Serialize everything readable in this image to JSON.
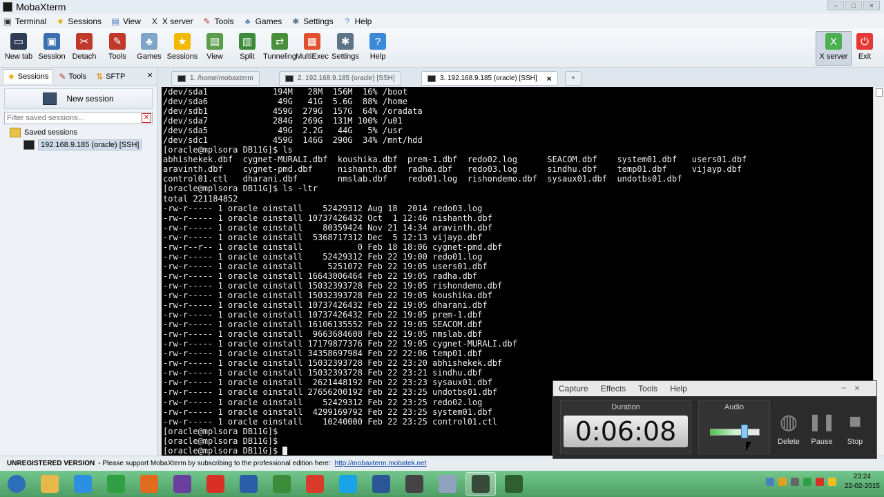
{
  "app": {
    "title": "MobaXterm"
  },
  "menu": [
    {
      "label": "Terminal",
      "icon": "terminal-icon"
    },
    {
      "label": "Sessions",
      "icon": "star-icon"
    },
    {
      "label": "View",
      "icon": "view-icon"
    },
    {
      "label": "X server",
      "icon": "x-icon"
    },
    {
      "label": "Tools",
      "icon": "tools-icon"
    },
    {
      "label": "Games",
      "icon": "games-icon"
    },
    {
      "label": "Settings",
      "icon": "settings-icon"
    },
    {
      "label": "Help",
      "icon": "help-icon"
    }
  ],
  "toolbar": {
    "buttons": [
      {
        "label": "New tab",
        "icon": "new-tab-icon",
        "color": "#2f3e55"
      },
      {
        "label": "Session",
        "icon": "session-icon",
        "color": "#3a6fb0"
      },
      {
        "label": "Detach",
        "icon": "detach-icon",
        "color": "#c0392b"
      },
      {
        "label": "Tools",
        "icon": "tools-icon",
        "color": "#c0392b"
      },
      {
        "label": "Games",
        "icon": "games-icon",
        "color": "#7fa6c8"
      },
      {
        "label": "Sessions",
        "icon": "star-icon",
        "color": "#f2b900"
      },
      {
        "label": "View",
        "icon": "view-icon",
        "color": "#5a9e4a"
      },
      {
        "label": "Split",
        "icon": "split-icon",
        "color": "#3c8a3a"
      },
      {
        "label": "Tunneling",
        "icon": "tunneling-icon",
        "color": "#4a8f3c"
      },
      {
        "label": "MultiExec",
        "icon": "multiexec-icon",
        "color": "#e0502d"
      },
      {
        "label": "Settings",
        "icon": "settings-icon",
        "color": "#5f7389"
      },
      {
        "label": "Help",
        "icon": "help-icon",
        "color": "#3b8ad9"
      }
    ],
    "right_buttons": [
      {
        "label": "X server",
        "icon": "x-server-icon",
        "color": "#4caf50",
        "active": true
      },
      {
        "label": "Exit",
        "icon": "exit-icon",
        "color": "#e53935"
      }
    ]
  },
  "left_panel": {
    "tabs": [
      {
        "label": "Sessions",
        "icon": "star-icon"
      },
      {
        "label": "Tools",
        "icon": "tools-icon"
      },
      {
        "label": "SFTP",
        "icon": "sftp-icon"
      }
    ],
    "close": "×",
    "new_session": "New session",
    "filter_placeholder": "Filter saved sessions...",
    "tree": {
      "folder": "Saved sessions",
      "items": [
        "192.168.9.185 (oracle) [SSH]"
      ]
    }
  },
  "term_tabs": [
    {
      "label": "1. /home/mobaxterm",
      "active": false
    },
    {
      "label": "2. 192.168.9.185 (oracle) [SSH]",
      "active": false
    },
    {
      "label": "3. 192.168.9.185 (oracle) [SSH]",
      "active": true
    }
  ],
  "terminal": {
    "lines": [
      "/dev/sda1             194M   28M  156M  16% /boot",
      "/dev/sda6              49G   41G  5.6G  88% /home",
      "/dev/sdb1             459G  279G  157G  64% /oradata",
      "/dev/sda7             284G  269G  131M 100% /u01",
      "/dev/sda5              49G  2.2G   44G   5% /usr",
      "/dev/sdc1             459G  146G  290G  34% /mnt/hdd",
      "[oracle@mplsora DB11G]$ ls",
      "abhishekek.dbf  cygnet-MURALI.dbf  koushika.dbf  prem-1.dbf  redo02.log      SEACOM.dbf    system01.dbf   users01.dbf",
      "aravinth.dbf    cygnet-pmd.dbf     nishanth.dbf  radha.dbf   redo03.log      sindhu.dbf    temp01.dbf     vijayp.dbf",
      "control01.ctl   dharani.dbf        nmslab.dbf    redo01.log  rishondemo.dbf  sysaux01.dbf  undotbs01.dbf",
      "[oracle@mplsora DB11G]$ ls -ltr",
      "total 221184852",
      "-rw-r----- 1 oracle oinstall    52429312 Aug 18  2014 redo03.log",
      "-rw-r----- 1 oracle oinstall 10737426432 Oct  1 12:46 nishanth.dbf",
      "-rw-r----- 1 oracle oinstall    80359424 Nov 21 14:34 aravinth.dbf",
      "-rw-r----- 1 oracle oinstall  5368717312 Dec  5 12:13 vijayp.dbf",
      "-rw-r--r-- 1 oracle oinstall           0 Feb 18 18:06 cygnet-pmd.dbf",
      "-rw-r----- 1 oracle oinstall    52429312 Feb 22 19:00 redo01.log",
      "-rw-r----- 1 oracle oinstall     5251072 Feb 22 19:05 users01.dbf",
      "-rw-r----- 1 oracle oinstall 16643006464 Feb 22 19:05 radha.dbf",
      "-rw-r----- 1 oracle oinstall 15032393728 Feb 22 19:05 rishondemo.dbf",
      "-rw-r----- 1 oracle oinstall 15032393728 Feb 22 19:05 koushika.dbf",
      "-rw-r----- 1 oracle oinstall 10737426432 Feb 22 19:05 dharani.dbf",
      "-rw-r----- 1 oracle oinstall 10737426432 Feb 22 19:05 prem-1.dbf",
      "-rw-r----- 1 oracle oinstall 16106135552 Feb 22 19:05 SEACOM.dbf",
      "-rw-r----- 1 oracle oinstall  9663684608 Feb 22 19:05 nmslab.dbf",
      "-rw-r----- 1 oracle oinstall 17179877376 Feb 22 19:05 cygnet-MURALI.dbf",
      "-rw-r----- 1 oracle oinstall 34358697984 Feb 22 22:06 temp01.dbf",
      "-rw-r----- 1 oracle oinstall 15032393728 Feb 22 23:20 abhishekek.dbf",
      "-rw-r----- 1 oracle oinstall 15032393728 Feb 22 23:21 sindhu.dbf",
      "-rw-r----- 1 oracle oinstall  2621448192 Feb 22 23:23 sysaux01.dbf",
      "-rw-r----- 1 oracle oinstall 27656200192 Feb 22 23:25 undotbs01.dbf",
      "-rw-r----- 1 oracle oinstall    52429312 Feb 22 23:25 redo02.log",
      "-rw-r----- 1 oracle oinstall  4299169792 Feb 22 23:25 system01.dbf",
      "-rw-r----- 1 oracle oinstall    10240000 Feb 22 23:25 control01.ctl",
      "[oracle@mplsora DB11G]$",
      "[oracle@mplsora DB11G]$"
    ],
    "prompt": "[oracle@mplsora DB11G]$ "
  },
  "statusbar": {
    "unregistered": "UNREGISTERED VERSION",
    "message": "-  Please support MobaXterm by subscribing to the professional edition here:",
    "link": "http://mobaxterm.mobatek.net"
  },
  "recorder": {
    "menu": [
      "Capture",
      "Effects",
      "Tools",
      "Help"
    ],
    "minimize": "–",
    "close": "×",
    "duration_label": "Duration",
    "duration": "0:06:08",
    "audio_label": "Audio",
    "audio_level": 0.7,
    "buttons": [
      {
        "label": "Delete",
        "icon": "delete-icon"
      },
      {
        "label": "Pause",
        "icon": "pause-icon"
      },
      {
        "label": "Stop",
        "icon": "stop-icon"
      }
    ]
  },
  "taskbar": {
    "apps": [
      {
        "icon": "start-orb-icon",
        "color": "#2a6fb8",
        "active": false
      },
      {
        "icon": "file-explorer-icon",
        "color": "#e8b84a",
        "active": false
      },
      {
        "icon": "internet-explorer-icon",
        "color": "#2d8fe0",
        "active": false
      },
      {
        "icon": "store-icon",
        "color": "#2ea043",
        "active": false
      },
      {
        "icon": "firefox-icon",
        "color": "#e06b1f",
        "active": false
      },
      {
        "icon": "visual-studio-icon",
        "color": "#6a3fa0",
        "active": false
      },
      {
        "icon": "chrome-icon",
        "color": "#d93025",
        "active": false
      },
      {
        "icon": "remote-desktop-icon",
        "color": "#2b5ea7",
        "active": false
      },
      {
        "icon": "project-icon",
        "color": "#3d8c3a",
        "active": false
      },
      {
        "icon": "acrobat-icon",
        "color": "#d93a2b",
        "active": false
      },
      {
        "icon": "skype-icon",
        "color": "#1aa3e8",
        "active": false
      },
      {
        "icon": "word-icon",
        "color": "#2b5797",
        "active": false
      },
      {
        "icon": "screen-icon",
        "color": "#444444",
        "active": false
      },
      {
        "icon": "database-icon",
        "color": "#8ea3bd",
        "active": false
      },
      {
        "icon": "mobaxterm-icon",
        "color": "#3a4a3a",
        "active": true
      },
      {
        "icon": "recorder-icon",
        "color": "#2f5f2f",
        "active": false
      }
    ],
    "clock_time": "23:24",
    "clock_date": "22-02-2015"
  }
}
